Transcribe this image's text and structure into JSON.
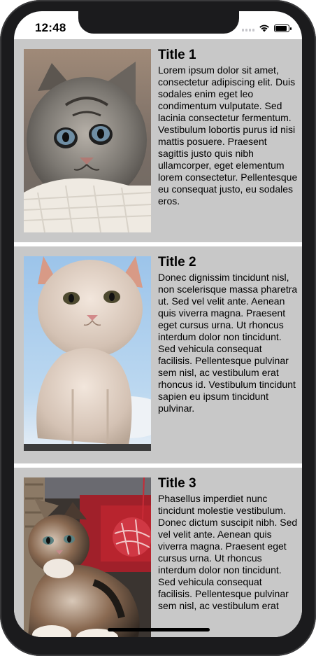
{
  "status_bar": {
    "time": "12:48",
    "signal_icon": "signal-icon",
    "wifi_icon": "wifi-icon",
    "battery_icon": "battery-icon"
  },
  "cards": [
    {
      "title": "Title 1",
      "body": "Lorem ipsum dolor sit amet, consectetur adipiscing elit. Duis sodales enim eget leo condimentum vulputate. Sed lacinia consectetur fermentum. Vestibulum lobortis purus id nisi mattis posuere. Praesent sagittis justo quis nibh ullamcorper, eget elementum lorem consectetur. Pellentesque eu consequat justo, eu sodales eros.",
      "image": "kitten-photo-gray-tabby"
    },
    {
      "title": "Title 2",
      "body": "Donec dignissim tincidunt nisl, non scelerisque massa pharetra ut. Sed vel velit ante. Aenean quis viverra magna. Praesent eget cursus urna. Ut rhoncus interdum dolor non tincidunt. Sed vehicula consequat facilisis. Pellentesque pulvinar sem nisl, ac vestibulum erat rhoncus id. Vestibulum tincidunt sapien eu ipsum tincidunt pulvinar.",
      "image": "kitten-photo-white-cream"
    },
    {
      "title": "Title 3",
      "body": "Phasellus imperdiet nunc tincidunt molestie vestibulum. Donec dictum suscipit nibh. Sed vel velit ante. Aenean quis viverra magna. Praesent eget cursus urna. Ut rhoncus interdum dolor non tincidunt. Sed vehicula consequat facilisis. Pellentesque pulvinar sem nisl, ac vestibulum erat",
      "image": "kitten-photo-calico"
    }
  ],
  "colors": {
    "card_background": "#c8c8c8",
    "divider": "#ffffff",
    "device_frame": "#1b1b1d"
  }
}
